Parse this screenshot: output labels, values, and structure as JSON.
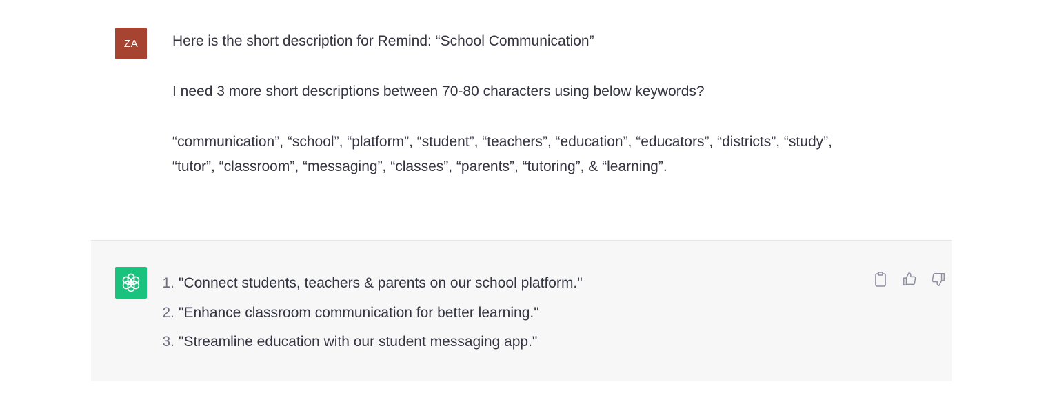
{
  "user_message": {
    "avatar_initials": "ZA",
    "avatar_color": "#a64331",
    "paragraphs": [
      "Here is the short description for Remind: “School Communication”",
      "I need 3 more short descriptions between 70-80 characters using below keywords?",
      "“communication”, “school”, “platform”, “student”, “teachers”, “education”, “educators”, “districts”, “study”, “tutor”, “classroom”, “messaging”, “classes”, “parents”, “tutoring”,  & “learning”."
    ]
  },
  "assistant_message": {
    "avatar_icon": "openai-logo-icon",
    "avatar_color": "#19c37d",
    "items": [
      {
        "number": "1.",
        "text": "\"Connect students, teachers & parents on our school platform.\""
      },
      {
        "number": "2.",
        "text": "\"Enhance classroom communication for better learning.\""
      },
      {
        "number": "3.",
        "text": "\"Streamline education with our student messaging app.\""
      }
    ],
    "actions": [
      "copy-icon",
      "thumbs-up-icon",
      "thumbs-down-icon"
    ]
  }
}
